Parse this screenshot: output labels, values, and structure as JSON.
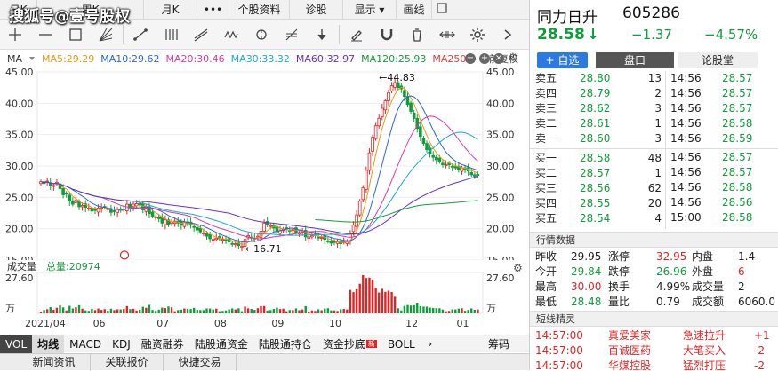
{
  "watermark": "搜狐号@壹号股权",
  "tabs": [
    "日K",
    "周K",
    "月K",
    "•••",
    "个股资料",
    "诊股",
    "显示 ▾",
    "画线"
  ],
  "indicator_label": "MA",
  "ma_legend": [
    {
      "label": "MA5:29.29",
      "color": "#e69a1a"
    },
    {
      "label": "MA10:29.62",
      "color": "#2a66d6"
    },
    {
      "label": "MA20:30.46",
      "color": "#d63a9e"
    },
    {
      "label": "MA30:33.32",
      "color": "#1fa8c9"
    },
    {
      "label": "MA60:32.97",
      "color": "#6a2fc4"
    },
    {
      "label": "MA120:25.93",
      "color": "#189a3b"
    },
    {
      "label": "MA250:--",
      "color": "#d94040"
    }
  ],
  "adjust_label": "前复权",
  "volume_title": "成交量",
  "volume_total": "总量:20974",
  "volume_unit": "万",
  "bottom_tabs": [
    "VOL",
    "均线",
    "MACD",
    "KDJ",
    "融资融券",
    "陆股通资金",
    "陆股通持仓",
    "资金抄底",
    "BOLL",
    "筹码"
  ],
  "bottom_nav": [
    "新闻资讯",
    "关联报价",
    "快捷交易"
  ],
  "new_badge": "新",
  "colors": {
    "up": "#e02424",
    "down": "#0f9d3a"
  },
  "stock": {
    "name": "同力日升",
    "code": "605286",
    "price": "28.58",
    "arrow": "↓",
    "change": "−1.37",
    "pct": "−4.57%"
  },
  "actions": {
    "add": "+ 自选",
    "tab1": "盘口",
    "tab2": "论股堂"
  },
  "sells": [
    {
      "label": "卖五",
      "price": "28.80",
      "vol": "13"
    },
    {
      "label": "卖四",
      "price": "28.79",
      "vol": "2"
    },
    {
      "label": "卖三",
      "price": "28.62",
      "vol": "3"
    },
    {
      "label": "卖二",
      "price": "28.61",
      "vol": "1"
    },
    {
      "label": "卖一",
      "price": "28.60",
      "vol": "3"
    }
  ],
  "buys": [
    {
      "label": "买一",
      "price": "28.58",
      "vol": "48"
    },
    {
      "label": "买二",
      "price": "28.57",
      "vol": "1"
    },
    {
      "label": "买三",
      "price": "28.56",
      "vol": "62"
    },
    {
      "label": "买四",
      "price": "28.55",
      "vol": "20"
    },
    {
      "label": "买五",
      "price": "28.54",
      "vol": "4"
    }
  ],
  "ticks": [
    {
      "time": "14:56",
      "price": "28.57"
    },
    {
      "time": "14:56",
      "price": "28.57"
    },
    {
      "time": "14:56",
      "price": "28.57"
    },
    {
      "time": "14:56",
      "price": "28.58"
    },
    {
      "time": "14:56",
      "price": "28.59"
    },
    {
      "time": "14:56",
      "price": "28.57"
    },
    {
      "time": "14:56",
      "price": "28.57"
    },
    {
      "time": "14:56",
      "price": "28.58"
    },
    {
      "time": "14:56",
      "price": "28.56"
    },
    {
      "time": "15:00",
      "price": "28.58"
    }
  ],
  "market_title": "行情数据",
  "market": [
    {
      "a": "昨收",
      "b": "29.95",
      "c": "涨停",
      "d": "32.95",
      "e": "内盘",
      "f": "1.4"
    },
    {
      "a": "今开",
      "b": "29.84",
      "c": "跌停",
      "d": "26.96",
      "e": "外盘",
      "f": "6"
    },
    {
      "a": "最高",
      "b": "30.00",
      "c": "换手",
      "d": "4.99%",
      "e": "成交量",
      "f": "2"
    },
    {
      "a": "最低",
      "b": "28.48",
      "c": "量比",
      "d": "0.79",
      "e": "成交额",
      "f": "6060.0"
    }
  ],
  "short_title": "短线精灵",
  "short_items": [
    {
      "time": "14:57:00",
      "name": "真爱美家",
      "event": "急速拉升",
      "v": "+1"
    },
    {
      "time": "14:57:00",
      "name": "百诚医药",
      "event": "大笔买入",
      "v": "-2"
    },
    {
      "time": "14:57:00",
      "name": "华媒控股",
      "event": "猛烈打压",
      "v": "-2"
    }
  ],
  "chart_data": {
    "type": "candlestick",
    "x_ticks": [
      "2021/04",
      "06",
      "07",
      "08",
      "09",
      "10",
      "12",
      "01"
    ],
    "y_ticks": [
      "45.00",
      "40.00",
      "35.00",
      "30.00",
      "25.00",
      "20.00",
      "15.00"
    ],
    "ylim": [
      15,
      45
    ],
    "annotations": [
      {
        "label": "←44.83"
      },
      {
        "label": "←16.71"
      }
    ],
    "volume_ticks": [
      "27.60",
      "万"
    ],
    "volume_ylim": [
      0,
      27.6
    ],
    "closes": [
      27.5,
      27.2,
      27.6,
      26.8,
      26.9,
      27.4,
      26.4,
      25.4,
      25.6,
      24.4,
      23.9,
      24.6,
      23.5,
      23.7,
      23.4,
      23.3,
      22.8,
      22.9,
      23.3,
      23.3,
      23.4,
      23.2,
      22.6,
      22.8,
      23.1,
      22.9,
      23.1,
      23.9,
      23.3,
      23.9,
      24,
      23.8,
      23,
      23.5,
      22.4,
      22,
      21.9,
      21.6,
      20.9,
      21.4,
      20.6,
      21.1,
      21.2,
      20.9,
      20.6,
      21.1,
      20.8,
      20.6,
      20.2,
      19.8,
      19.5,
      19.3,
      18.8,
      18.4,
      18.3,
      18.5,
      18.4,
      18.3,
      18.2,
      17.9,
      17.5,
      17.6,
      17.3,
      17.2,
      18.3,
      18.9,
      18.5,
      18.4,
      18.8,
      19.6,
      20.9,
      20.7,
      20.5,
      20.1,
      19.5,
      19.7,
      19.9,
      20,
      19.7,
      19.9,
      19.4,
      19.4,
      19.5,
      18.7,
      18.7,
      18.9,
      18.9,
      18.6,
      18.6,
      18.3,
      18,
      17.7,
      17.9,
      17.9,
      17.6,
      17.9,
      18,
      19.3,
      20.6,
      22.2,
      24.4,
      26.5,
      29.3,
      32.1,
      34.6,
      36.4,
      37.6,
      39.2,
      40.4,
      41.7,
      42.8,
      43.3,
      42.5,
      42.3,
      41.1,
      39.8,
      38.7,
      37.6,
      36,
      34.7,
      33.6,
      32.6,
      31.9,
      31.4,
      31,
      30.7,
      30.2,
      30.2,
      30.2,
      29.9,
      29.7,
      29.4,
      29.7,
      29.5,
      29.2,
      28.6,
      28.4,
      28.58
    ],
    "ma_series_order": [
      "MA5",
      "MA10",
      "MA20",
      "MA30",
      "MA60",
      "MA120"
    ]
  }
}
